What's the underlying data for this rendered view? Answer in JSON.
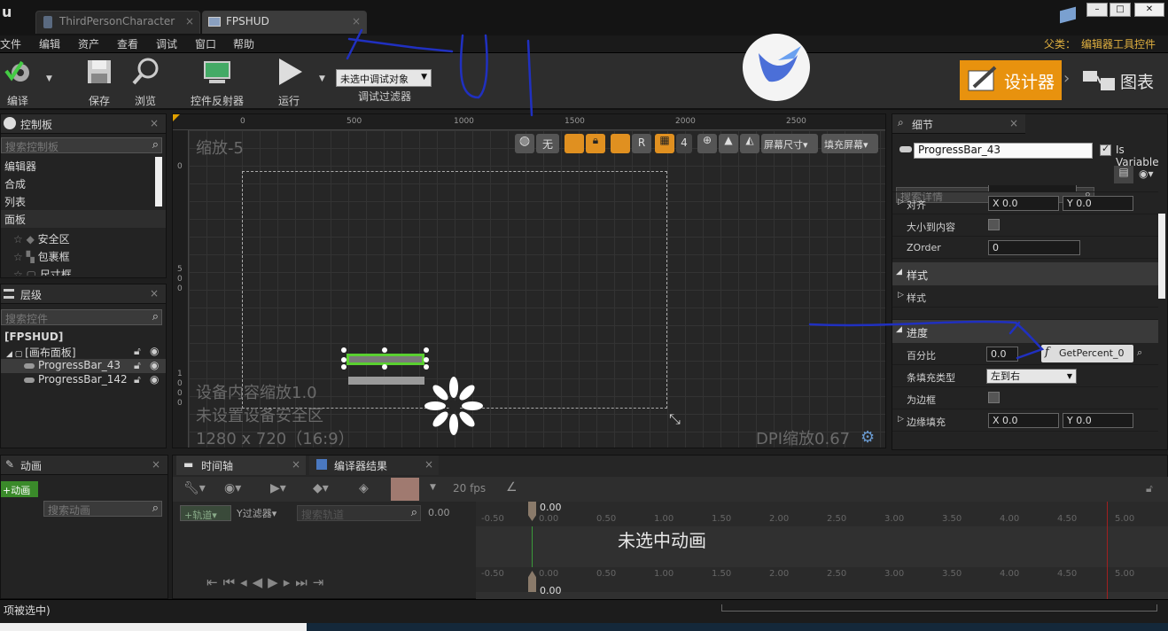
{
  "tabs": [
    {
      "label": "ThirdPersonCharacter",
      "active": false
    },
    {
      "label": "FPSHUD",
      "active": true
    }
  ],
  "window_buttons": [
    "–",
    "□",
    "✕"
  ],
  "menu": [
    "文件",
    "编辑",
    "资产",
    "查看",
    "调试",
    "窗口",
    "帮助"
  ],
  "parent_class": {
    "label": "父类：",
    "value": "编辑器工具控件"
  },
  "toolbar": {
    "compile": "编译",
    "save": "保存",
    "browse": "浏览",
    "reflector": "控件反射器",
    "run": "运行",
    "debug_target": "未选中调试对象",
    "debug_filter": "调试过滤器"
  },
  "mode": {
    "designer": "设计器",
    "graph": "图表"
  },
  "palette": {
    "title": "控制板",
    "search_placeholder": "搜索控制板",
    "categories": [
      "编辑器",
      "合成",
      "列表",
      "面板"
    ],
    "items": [
      "安全区",
      "包裹框",
      "尺寸框"
    ]
  },
  "hierarchy": {
    "title": "层级",
    "search_placeholder": "搜索控件",
    "root": "[FPSHUD]",
    "canvas": "[画布面板]",
    "children": [
      "ProgressBar_43",
      "ProgressBar_142"
    ]
  },
  "designer": {
    "zoom": "缩放-5",
    "ruler": [
      "0",
      "500",
      "1000",
      "1500",
      "2000",
      "2500"
    ],
    "vruler": [
      "0",
      "5",
      "0",
      "0",
      "1",
      "0",
      "0",
      "0"
    ],
    "device_scale": "设备内容缩放1.0",
    "safe_zone": "未设置设备安全区",
    "resolution": "1280 x 720（16:9）",
    "dpi": "DPI缩放0.67",
    "tools": {
      "none": "无",
      "r": "R",
      "four": "4",
      "screen_size": "屏幕尺寸",
      "fill_screen": "填充屏幕"
    }
  },
  "details": {
    "title": "细节",
    "name_value": "ProgressBar_43",
    "is_variable": "Is Variable",
    "search_placeholder": "搜索详情",
    "rows": {
      "align": "对齐",
      "align_x": "X 0.0",
      "align_y": "Y 0.0",
      "size_to_content": "大小到内容",
      "zorder": "ZOrder",
      "zorder_value": "0",
      "style_section": "样式",
      "style_row": "样式",
      "progress_section": "进度",
      "percent": "百分比",
      "percent_value": "0.0",
      "bind_func": "GetPercent_0",
      "fill_type": "条填充类型",
      "fill_type_value": "左到右",
      "is_marquee": "为边框",
      "border_padding": "边缘填充",
      "pad_x": "X 0.0",
      "pad_y": "Y 0.0"
    }
  },
  "animations": {
    "title": "动画",
    "add": "+动画",
    "search_placeholder": "搜索动画"
  },
  "timeline": {
    "tab1": "时间轴",
    "tab2": "编译器结果",
    "fps": "20 fps",
    "track_btn": "轨道",
    "filter": "过滤器",
    "search_placeholder": "搜索轨道",
    "time_value": "0.00",
    "no_animation": "未选中动画",
    "ticks": [
      "-0.50",
      "0.00",
      "0.50",
      "1.00",
      "1.50",
      "2.00",
      "2.50",
      "3.00",
      "3.50",
      "4.00",
      "4.50",
      "5.00"
    ],
    "playhead_top": "0.00",
    "playhead_bottom": "0.00"
  },
  "status": {
    "text": "项被选中)"
  }
}
